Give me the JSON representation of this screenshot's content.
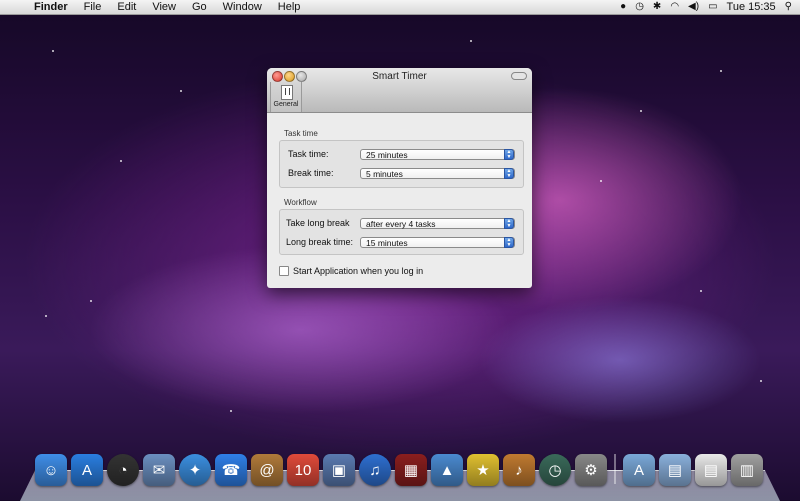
{
  "menubar": {
    "app_name": "Finder",
    "items": [
      "File",
      "Edit",
      "View",
      "Go",
      "Window",
      "Help"
    ],
    "clock": "Tue 15:35"
  },
  "window": {
    "title": "Smart Timer",
    "toolbar_tab": "General",
    "task_group": {
      "label": "Task time",
      "rows": [
        {
          "label": "Task time:",
          "value": "25 minutes"
        },
        {
          "label": "Break time:",
          "value": "5 minutes"
        }
      ]
    },
    "workflow_group": {
      "label": "Workflow",
      "rows": [
        {
          "label": "Take long break",
          "value": "after every 4 tasks"
        },
        {
          "label": "Long break time:",
          "value": "15 minutes"
        }
      ]
    },
    "startup_checkbox": {
      "label": "Start Application when you log in",
      "checked": false
    }
  },
  "dock": {
    "apps": [
      {
        "name": "finder-icon",
        "color": "#3f8ee8"
      },
      {
        "name": "app-store-icon",
        "color": "#2a7ee0"
      },
      {
        "name": "dashboard-icon",
        "color": "#333333"
      },
      {
        "name": "mail-icon",
        "color": "#6b8fc0"
      },
      {
        "name": "safari-icon",
        "color": "#3b8fe0"
      },
      {
        "name": "ichat-icon",
        "color": "#2f7fe8"
      },
      {
        "name": "address-book-icon",
        "color": "#b07a3a"
      },
      {
        "name": "ical-icon",
        "color": "#e04a3a"
      },
      {
        "name": "preview-icon",
        "color": "#5a7ab0"
      },
      {
        "name": "itunes-icon",
        "color": "#2e6fd0"
      },
      {
        "name": "photo-booth-icon",
        "color": "#8a1e1e"
      },
      {
        "name": "iphoto-icon",
        "color": "#4a8ad0"
      },
      {
        "name": "imovie-icon",
        "color": "#e0c030"
      },
      {
        "name": "garageband-icon",
        "color": "#c07a30"
      },
      {
        "name": "time-machine-icon",
        "color": "#3a6a5a"
      },
      {
        "name": "system-preferences-icon",
        "color": "#888888"
      }
    ],
    "stacks": [
      {
        "name": "applications-folder-icon",
        "color": "#7aa8d8"
      },
      {
        "name": "documents-folder-icon",
        "color": "#8ab0dc"
      },
      {
        "name": "downloads-stack-icon",
        "color": "#e8e8e8"
      },
      {
        "name": "trash-icon",
        "color": "#a0a0a0"
      }
    ]
  }
}
